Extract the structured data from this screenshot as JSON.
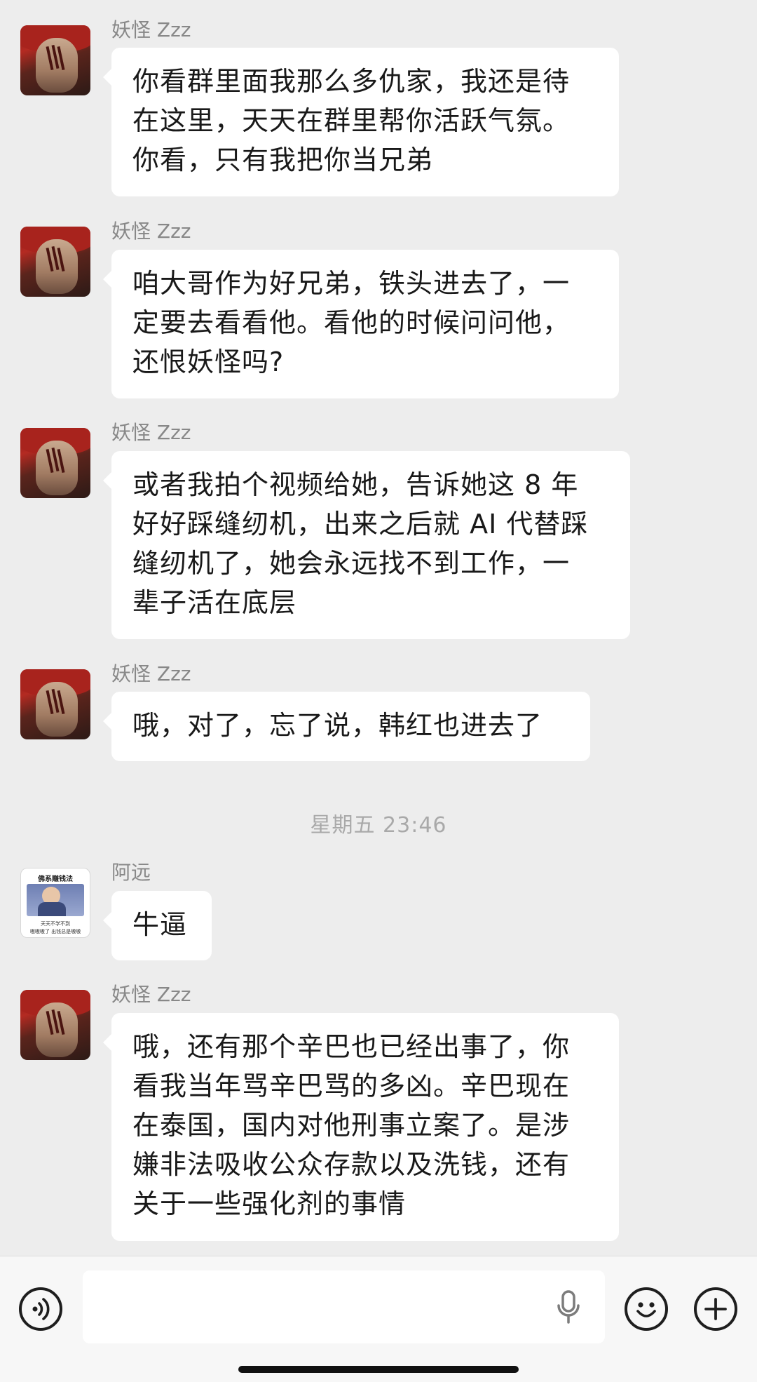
{
  "messages": [
    {
      "sender": "妖怪 Zzz",
      "avatar": "shanks-avatar",
      "lines": [
        "你看群里面我那么多仇家，我还是待",
        "在这里，天天在群里帮你活跃气氛。",
        "你看，只有我把你当兄弟"
      ]
    },
    {
      "sender": "妖怪 Zzz",
      "avatar": "shanks-avatar",
      "lines": [
        "咱大哥作为好兄弟，铁头进去了，一",
        "定要去看看他。看他的时候问问他，",
        "还恨妖怪吗?"
      ]
    },
    {
      "sender": "妖怪 Zzz",
      "avatar": "shanks-avatar",
      "lines": [
        "或者我拍个视频给她，告诉她这 8 年",
        "好好踩缝纫机，出来之后就 AI 代替踩",
        "缝纫机了，她会永远找不到工作，一",
        "辈子活在底层"
      ]
    },
    {
      "sender": "妖怪 Zzz",
      "avatar": "shanks-avatar",
      "lines": [
        "哦，对了，忘了说，韩红也进去了"
      ]
    },
    {
      "sender": "阿远",
      "avatar": "buddha-avatar",
      "lines": [
        "牛逼"
      ]
    },
    {
      "sender": "妖怪 Zzz",
      "avatar": "shanks-avatar",
      "lines": [
        "哦，还有那个辛巴也已经出事了，你",
        "看我当年骂辛巴骂的多凶。辛巴现在",
        "在泰国，国内对他刑事立案了。是涉",
        "嫌非法吸收公众存款以及洗钱，还有",
        "关于一些强化剂的事情"
      ]
    }
  ],
  "timestamp": "星期五 23:46",
  "yuan_avatar": {
    "title": "佛系赚钱法",
    "caption1": "天天不学不到",
    "caption2": "嗷嗷嗷了 出钱总是嗷嗷"
  },
  "input_bar": {
    "placeholder": "",
    "icons": [
      "voice-icon",
      "microphone-icon",
      "emoji-icon",
      "plus-icon"
    ]
  },
  "colors": {
    "background": "#ededed",
    "bubble": "#ffffff",
    "text": "#191919",
    "sender_name": "#888888",
    "timestamp": "#a9a9a9"
  }
}
